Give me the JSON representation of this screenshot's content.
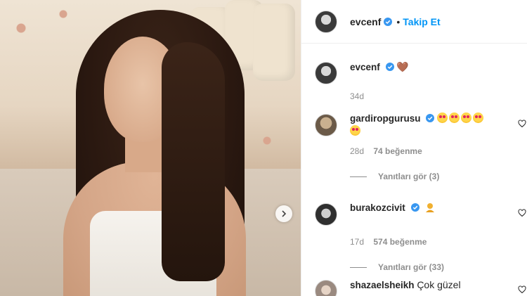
{
  "post": {
    "author": "evcenf",
    "follow_label": "Takip Et",
    "dot": "•"
  },
  "caption": {
    "username": "evcenf",
    "emoji": "🤎",
    "time": "34d"
  },
  "comments": [
    {
      "username": "gardiropgurusu",
      "time": "28d",
      "likes": "74 beğenme",
      "replies": "Yanıtları gör (3)"
    },
    {
      "username": "burakozcivit",
      "time": "17d",
      "likes": "574 beğenme",
      "replies": "Yanıtları gör (33)"
    },
    {
      "username": "shazaelsheikh",
      "text": "Çok güzel"
    }
  ],
  "colors": {
    "accent": "#0095f6",
    "verified": "#3897f0"
  }
}
